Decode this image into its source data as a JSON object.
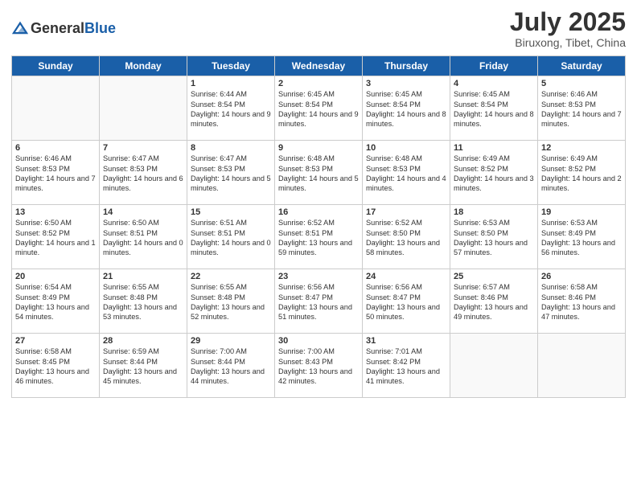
{
  "header": {
    "logo_general": "General",
    "logo_blue": "Blue",
    "month": "July 2025",
    "location": "Biruxong, Tibet, China"
  },
  "weekdays": [
    "Sunday",
    "Monday",
    "Tuesday",
    "Wednesday",
    "Thursday",
    "Friday",
    "Saturday"
  ],
  "weeks": [
    [
      {
        "day": "",
        "text": ""
      },
      {
        "day": "",
        "text": ""
      },
      {
        "day": "1",
        "text": "Sunrise: 6:44 AM\nSunset: 8:54 PM\nDaylight: 14 hours and 9 minutes."
      },
      {
        "day": "2",
        "text": "Sunrise: 6:45 AM\nSunset: 8:54 PM\nDaylight: 14 hours and 9 minutes."
      },
      {
        "day": "3",
        "text": "Sunrise: 6:45 AM\nSunset: 8:54 PM\nDaylight: 14 hours and 8 minutes."
      },
      {
        "day": "4",
        "text": "Sunrise: 6:45 AM\nSunset: 8:54 PM\nDaylight: 14 hours and 8 minutes."
      },
      {
        "day": "5",
        "text": "Sunrise: 6:46 AM\nSunset: 8:53 PM\nDaylight: 14 hours and 7 minutes."
      }
    ],
    [
      {
        "day": "6",
        "text": "Sunrise: 6:46 AM\nSunset: 8:53 PM\nDaylight: 14 hours and 7 minutes."
      },
      {
        "day": "7",
        "text": "Sunrise: 6:47 AM\nSunset: 8:53 PM\nDaylight: 14 hours and 6 minutes."
      },
      {
        "day": "8",
        "text": "Sunrise: 6:47 AM\nSunset: 8:53 PM\nDaylight: 14 hours and 5 minutes."
      },
      {
        "day": "9",
        "text": "Sunrise: 6:48 AM\nSunset: 8:53 PM\nDaylight: 14 hours and 5 minutes."
      },
      {
        "day": "10",
        "text": "Sunrise: 6:48 AM\nSunset: 8:53 PM\nDaylight: 14 hours and 4 minutes."
      },
      {
        "day": "11",
        "text": "Sunrise: 6:49 AM\nSunset: 8:52 PM\nDaylight: 14 hours and 3 minutes."
      },
      {
        "day": "12",
        "text": "Sunrise: 6:49 AM\nSunset: 8:52 PM\nDaylight: 14 hours and 2 minutes."
      }
    ],
    [
      {
        "day": "13",
        "text": "Sunrise: 6:50 AM\nSunset: 8:52 PM\nDaylight: 14 hours and 1 minute."
      },
      {
        "day": "14",
        "text": "Sunrise: 6:50 AM\nSunset: 8:51 PM\nDaylight: 14 hours and 0 minutes."
      },
      {
        "day": "15",
        "text": "Sunrise: 6:51 AM\nSunset: 8:51 PM\nDaylight: 14 hours and 0 minutes."
      },
      {
        "day": "16",
        "text": "Sunrise: 6:52 AM\nSunset: 8:51 PM\nDaylight: 13 hours and 59 minutes."
      },
      {
        "day": "17",
        "text": "Sunrise: 6:52 AM\nSunset: 8:50 PM\nDaylight: 13 hours and 58 minutes."
      },
      {
        "day": "18",
        "text": "Sunrise: 6:53 AM\nSunset: 8:50 PM\nDaylight: 13 hours and 57 minutes."
      },
      {
        "day": "19",
        "text": "Sunrise: 6:53 AM\nSunset: 8:49 PM\nDaylight: 13 hours and 56 minutes."
      }
    ],
    [
      {
        "day": "20",
        "text": "Sunrise: 6:54 AM\nSunset: 8:49 PM\nDaylight: 13 hours and 54 minutes."
      },
      {
        "day": "21",
        "text": "Sunrise: 6:55 AM\nSunset: 8:48 PM\nDaylight: 13 hours and 53 minutes."
      },
      {
        "day": "22",
        "text": "Sunrise: 6:55 AM\nSunset: 8:48 PM\nDaylight: 13 hours and 52 minutes."
      },
      {
        "day": "23",
        "text": "Sunrise: 6:56 AM\nSunset: 8:47 PM\nDaylight: 13 hours and 51 minutes."
      },
      {
        "day": "24",
        "text": "Sunrise: 6:56 AM\nSunset: 8:47 PM\nDaylight: 13 hours and 50 minutes."
      },
      {
        "day": "25",
        "text": "Sunrise: 6:57 AM\nSunset: 8:46 PM\nDaylight: 13 hours and 49 minutes."
      },
      {
        "day": "26",
        "text": "Sunrise: 6:58 AM\nSunset: 8:46 PM\nDaylight: 13 hours and 47 minutes."
      }
    ],
    [
      {
        "day": "27",
        "text": "Sunrise: 6:58 AM\nSunset: 8:45 PM\nDaylight: 13 hours and 46 minutes."
      },
      {
        "day": "28",
        "text": "Sunrise: 6:59 AM\nSunset: 8:44 PM\nDaylight: 13 hours and 45 minutes."
      },
      {
        "day": "29",
        "text": "Sunrise: 7:00 AM\nSunset: 8:44 PM\nDaylight: 13 hours and 44 minutes."
      },
      {
        "day": "30",
        "text": "Sunrise: 7:00 AM\nSunset: 8:43 PM\nDaylight: 13 hours and 42 minutes."
      },
      {
        "day": "31",
        "text": "Sunrise: 7:01 AM\nSunset: 8:42 PM\nDaylight: 13 hours and 41 minutes."
      },
      {
        "day": "",
        "text": ""
      },
      {
        "day": "",
        "text": ""
      }
    ]
  ]
}
